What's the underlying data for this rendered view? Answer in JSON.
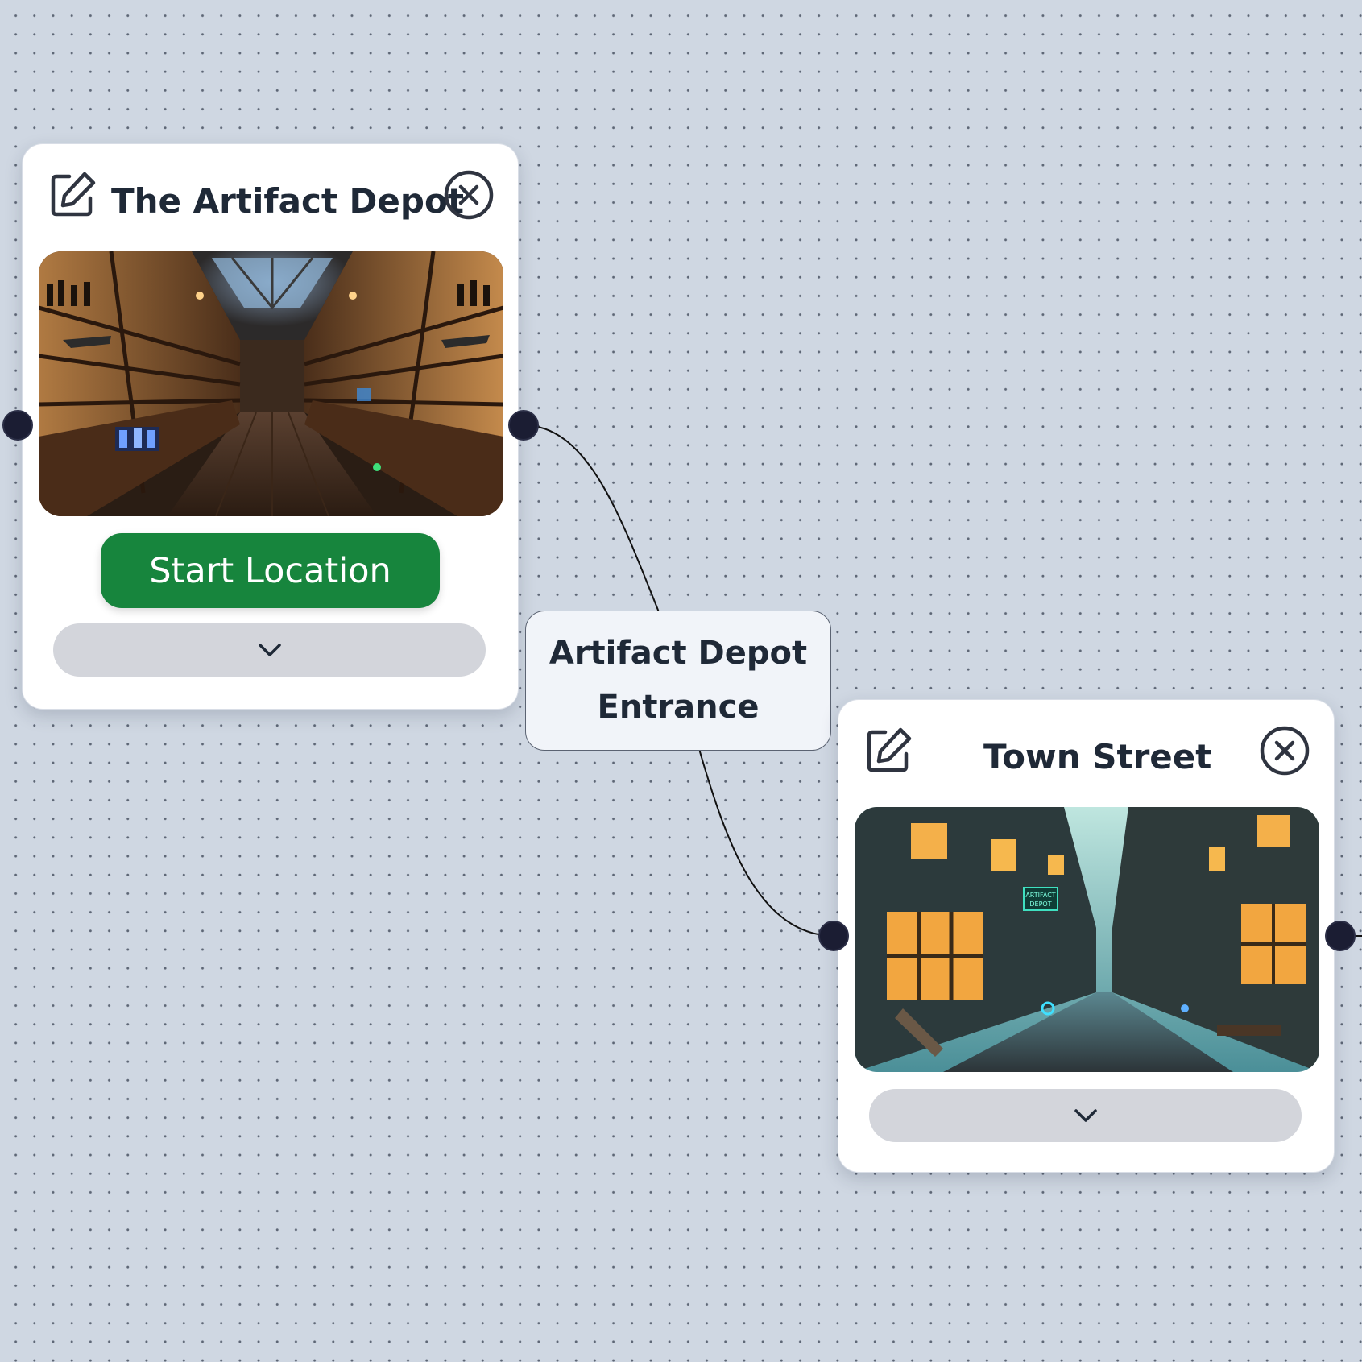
{
  "nodes": {
    "artifact_depot": {
      "title": "The Artifact Depot",
      "start_label": "Start Location",
      "image": "shop-interior"
    },
    "town_street": {
      "title": "Town Street",
      "image": "street-scene"
    }
  },
  "edge": {
    "label_line1": "Artifact Depot",
    "label_line2": "Entrance"
  },
  "street_sign": {
    "line1": "ARTIFACT",
    "line2": "DEPOT"
  },
  "icons": {
    "edit": "edit-icon",
    "close": "close-circle-icon",
    "expand": "chevron-down-icon"
  },
  "colors": {
    "start_button": "#17853d",
    "handle": "#1b1d33",
    "canvas": "#cfd7e2"
  }
}
